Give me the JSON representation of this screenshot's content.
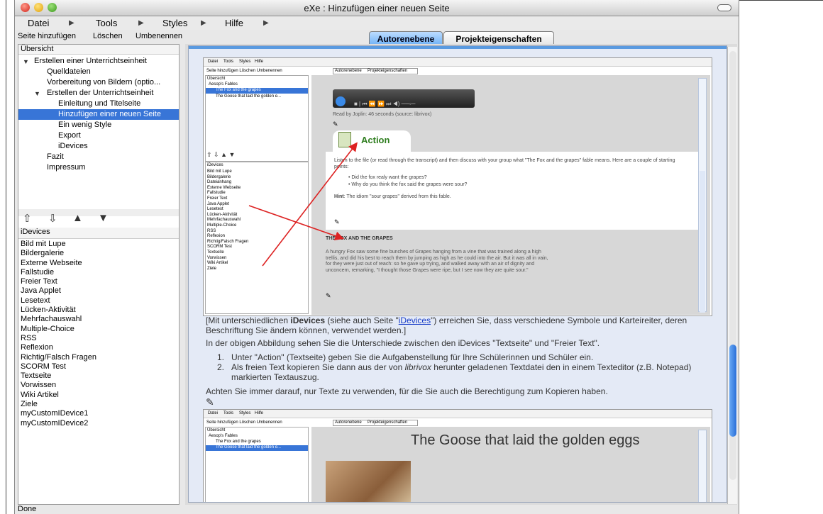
{
  "window": {
    "title": "eXe : Hinzufügen einer neuen Seite"
  },
  "menu": {
    "items": [
      "Datei",
      "Tools",
      "Styles",
      "Hilfe"
    ]
  },
  "toolbar": {
    "add_page": "Seite hinzufügen",
    "delete": "Löschen",
    "rename": "Umbenennen"
  },
  "tabs": {
    "author": "Autorenebene",
    "properties": "Projekteigenschaften"
  },
  "outline": {
    "header": "Übersicht",
    "items": [
      "Erstellen einer Unterrichtseinheit",
      "Quelldateien",
      "Vorbereitung von Bildern (optio...",
      "Erstellen der Unterrichtseinheit",
      "Einleitung und Titelseite",
      "Hinzufügen einer neuen Seite",
      "Ein wenig Style",
      "Export",
      "iDevices",
      "Fazit",
      "Impressum"
    ]
  },
  "idevices": {
    "header": "iDevices",
    "items": [
      "Bild mit Lupe",
      "Bildergalerie",
      "Externe Webseite",
      "Fallstudie",
      "Freier Text",
      "Java Applet",
      "Lesetext",
      "Lücken-Aktivität",
      "Mehrfachauswahl",
      "Multiple-Choice",
      "RSS",
      "Reflexion",
      "Richtig/Falsch Fragen",
      "SCORM Test",
      "Textseite",
      "Vorwissen",
      "Wiki Artikel",
      "Ziele",
      "myCustomIDevice1",
      "myCustomIDevice2"
    ]
  },
  "screenshot1": {
    "menu": [
      "Datei",
      "Tools",
      "Styles",
      "Hilfe"
    ],
    "toolbar": "Seite hinzufügen  Löschen  Umbenennen",
    "tabs": [
      "Autorenebene",
      "Projekteigenschaften"
    ],
    "outline": [
      "Übersicht",
      "Aesop's Fables",
      "The Fox and the grapes",
      "The Goose that laid the golden e..."
    ],
    "idev_header": "iDevices",
    "idev_items": [
      "Bild mit Lupe",
      "Bildergalerie",
      "Dateianhang",
      "Externe Webseite",
      "Fallstudie",
      "Freier Text",
      "Java Applet",
      "Lesetext",
      "Lücken-Aktivität",
      "Mehrfachauswahl",
      "Multiple-Choice",
      "RSS",
      "Reflexion",
      "Richtig/Falsch Fragen",
      "SCORM Test",
      "Textseite",
      "Vorwissen",
      "Wiki Artikel",
      "Ziele"
    ],
    "read_by": "Read by Joplin: 46 seconds (source: librivox)",
    "action_title": "Action",
    "action_text": "Listen to the file (or read through the transcript) and then discuss with your group what \"The Fox and the grapes\" fable means. Here are a couple of starting points:",
    "bullets": [
      "Did the fox realy want the grapes?",
      "Why do you think the fox said the grapes were sour?"
    ],
    "hint_label": "Hint",
    "hint": ": The idiom \"sour grapes\" derived from this fable.",
    "fable_title": "THE FOX AND THE GRAPES",
    "fable_text": "A hungry Fox saw some fine bunches of Grapes hanging from a vine that was trained along a high trellis, and did his best to reach them by jumping as high as he could into the air. But it was all in vain, for they were just out of reach: so he gave up trying, and walked away with an air of dignity and unconcern, remarking, \"I thought those Grapes were ripe, but I see now they are quite sour.\""
  },
  "body": {
    "p1_a": "[Mit unterschiedlichen ",
    "p1_b": "iDevices",
    "p1_c": " (siehe auch Seite \"",
    "p1_link": "iDevices",
    "p1_d": "\") erreichen Sie, dass verschiedene Symbole und Karteireiter, deren Beschriftung Sie ändern können, verwendet werden.]",
    "p2": "In der obigen Abbildung sehen Sie die Unterschiede zwischen den iDevices \"Textseite\" und \"Freier Text\".",
    "li1": "Unter \"Action\" (Textseite) geben Sie die Aufgabenstellung für Ihre Schülerinnen und Schüler ein.",
    "li2_a": "Als freien Text kopieren Sie dann aus der von ",
    "li2_em": "librivox",
    "li2_b": " herunter geladenen Textdatei den in einem Texteditor (z.B. Notepad) markierten Textauszug.",
    "p3": "Achten Sie immer darauf, nur Texte zu verwenden, für die Sie auch die Berechtigung zum Kopieren haben."
  },
  "screenshot2": {
    "menu": [
      "Datei",
      "Tools",
      "Styles",
      "Hilfe"
    ],
    "toolbar": "Seite hinzufügen  Löschen  Umbenennen",
    "tabs": [
      "Autorenebene",
      "Projekteigenschaften"
    ],
    "outline": [
      "Übersicht",
      "Aesop's Fables",
      "The Fox and the grapes",
      "The Goose that laid the golden e..."
    ],
    "title": "The Goose that laid the golden eggs"
  },
  "status": {
    "text": "Done"
  },
  "colors": {
    "accent": "#3875d7",
    "content_bg": "#e4eaf6",
    "action_green": "#2e7d1e",
    "arrow_red": "#dd2222"
  }
}
